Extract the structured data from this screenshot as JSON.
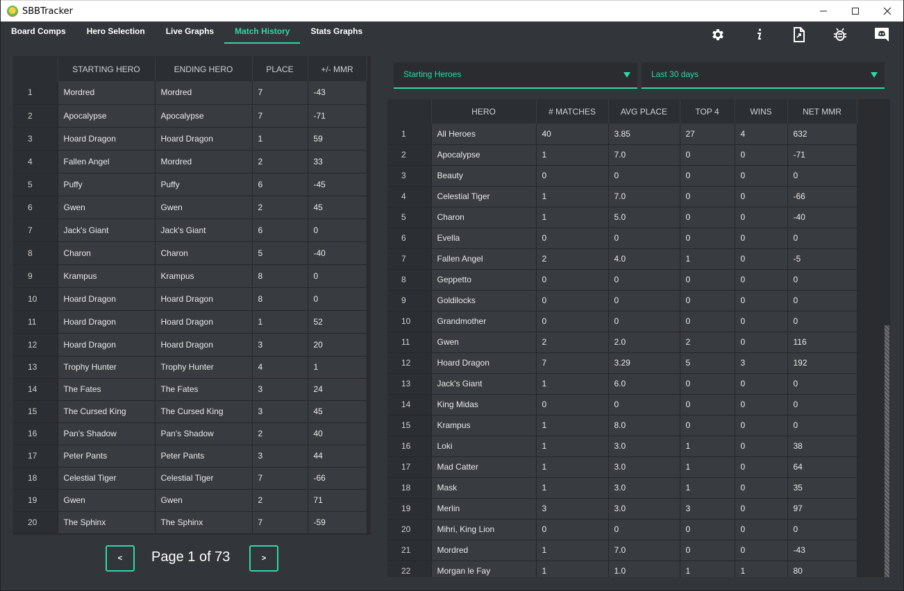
{
  "window": {
    "title": "SBBTracker",
    "minimize": "—",
    "maximize": "☐",
    "close": "✕"
  },
  "nav": {
    "tabs": [
      "Board Comps",
      "Hero Selection",
      "Live Graphs",
      "Match History",
      "Stats Graphs"
    ],
    "active_tab": "Match History",
    "icons": [
      "settings-icon",
      "info-icon",
      "export-icon",
      "bug-report-icon",
      "discord-icon"
    ]
  },
  "history": {
    "headers": [
      "",
      "STARTING HERO",
      "ENDING HERO",
      "PLACE",
      "+/- MMR"
    ],
    "rows": [
      [
        "1",
        "Mordred",
        "Mordred",
        "7",
        "-43"
      ],
      [
        "2",
        "Apocalypse",
        "Apocalypse",
        "7",
        "-71"
      ],
      [
        "3",
        "Hoard Dragon",
        "Hoard Dragon",
        "1",
        "59"
      ],
      [
        "4",
        "Fallen Angel",
        "Mordred",
        "2",
        "33"
      ],
      [
        "5",
        "Puffy",
        "Puffy",
        "6",
        "-45"
      ],
      [
        "6",
        "Gwen",
        "Gwen",
        "2",
        "45"
      ],
      [
        "7",
        "Jack's Giant",
        "Jack's Giant",
        "6",
        "0"
      ],
      [
        "8",
        "Charon",
        "Charon",
        "5",
        "-40"
      ],
      [
        "9",
        "Krampus",
        "Krampus",
        "8",
        "0"
      ],
      [
        "10",
        "Hoard Dragon",
        "Hoard Dragon",
        "8",
        "0"
      ],
      [
        "11",
        "Hoard Dragon",
        "Hoard Dragon",
        "1",
        "52"
      ],
      [
        "12",
        "Hoard Dragon",
        "Hoard Dragon",
        "3",
        "20"
      ],
      [
        "13",
        "Trophy Hunter",
        "Trophy Hunter",
        "4",
        "1"
      ],
      [
        "14",
        "The Fates",
        "The Fates",
        "3",
        "24"
      ],
      [
        "15",
        "The Cursed King",
        "The Cursed King",
        "3",
        "45"
      ],
      [
        "16",
        "Pan's Shadow",
        "Pan's Shadow",
        "2",
        "40"
      ],
      [
        "17",
        "Peter Pants",
        "Peter Pants",
        "3",
        "44"
      ],
      [
        "18",
        "Celestial Tiger",
        "Celestial Tiger",
        "7",
        "-66"
      ],
      [
        "19",
        "Gwen",
        "Gwen",
        "2",
        "71"
      ],
      [
        "20",
        "The Sphinx",
        "The Sphinx",
        "7",
        "-59"
      ]
    ],
    "pager": {
      "prev": "<",
      "next": ">",
      "page_text": "Page 1 of 73"
    }
  },
  "filters": {
    "hero_filter": "Starting Heroes",
    "time_filter": "Last 30 days"
  },
  "stats": {
    "headers": [
      "",
      "HERO",
      "# MATCHES",
      "AVG PLACE",
      "TOP 4",
      "WINS",
      "NET MMR"
    ],
    "rows": [
      [
        "1",
        "All Heroes",
        "40",
        "3.85",
        "27",
        "4",
        "632"
      ],
      [
        "2",
        "Apocalypse",
        "1",
        "7.0",
        "0",
        "0",
        "-71"
      ],
      [
        "3",
        "Beauty",
        "0",
        "0",
        "0",
        "0",
        "0"
      ],
      [
        "4",
        "Celestial Tiger",
        "1",
        "7.0",
        "0",
        "0",
        "-66"
      ],
      [
        "5",
        "Charon",
        "1",
        "5.0",
        "0",
        "0",
        "-40"
      ],
      [
        "6",
        "Evella",
        "0",
        "0",
        "0",
        "0",
        "0"
      ],
      [
        "7",
        "Fallen Angel",
        "2",
        "4.0",
        "1",
        "0",
        "-5"
      ],
      [
        "8",
        "Geppetto",
        "0",
        "0",
        "0",
        "0",
        "0"
      ],
      [
        "9",
        "Goldilocks",
        "0",
        "0",
        "0",
        "0",
        "0"
      ],
      [
        "10",
        "Grandmother",
        "0",
        "0",
        "0",
        "0",
        "0"
      ],
      [
        "11",
        "Gwen",
        "2",
        "2.0",
        "2",
        "0",
        "116"
      ],
      [
        "12",
        "Hoard Dragon",
        "7",
        "3.29",
        "5",
        "3",
        "192"
      ],
      [
        "13",
        "Jack's Giant",
        "1",
        "6.0",
        "0",
        "0",
        "0"
      ],
      [
        "14",
        "King Midas",
        "0",
        "0",
        "0",
        "0",
        "0"
      ],
      [
        "15",
        "Krampus",
        "1",
        "8.0",
        "0",
        "0",
        "0"
      ],
      [
        "16",
        "Loki",
        "1",
        "3.0",
        "1",
        "0",
        "38"
      ],
      [
        "17",
        "Mad Catter",
        "1",
        "3.0",
        "1",
        "0",
        "64"
      ],
      [
        "18",
        "Mask",
        "1",
        "3.0",
        "1",
        "0",
        "35"
      ],
      [
        "19",
        "Merlin",
        "3",
        "3.0",
        "3",
        "0",
        "97"
      ],
      [
        "20",
        "Mihri, King Lion",
        "0",
        "0",
        "0",
        "0",
        "0"
      ],
      [
        "21",
        "Mordred",
        "1",
        "7.0",
        "0",
        "0",
        "-43"
      ],
      [
        "22",
        "Morgan le Fay",
        "1",
        "1.0",
        "1",
        "1",
        "80"
      ]
    ]
  },
  "colors": {
    "accent": "#2ed8a8",
    "background": "#323539",
    "table_cell": "#383b40",
    "table_header": "#2b2e33"
  }
}
